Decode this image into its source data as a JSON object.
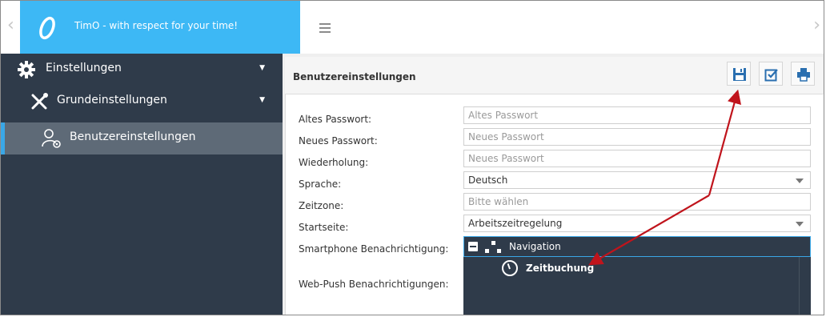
{
  "header": {
    "app_title": "TimO - with respect for your time!",
    "nav_prev": "‹",
    "nav_next": "›"
  },
  "sidebar": {
    "items": [
      {
        "label": "Einstellungen",
        "icon": "gear-icon",
        "caret": "▼"
      },
      {
        "label": "Grundeinstellungen",
        "icon": "tools-icon",
        "caret": "▼"
      },
      {
        "label": "Benutzereinstellungen",
        "icon": "user-settings-icon",
        "active": true
      }
    ]
  },
  "panel": {
    "title": "Benutzereinstellungen",
    "toolbar": {
      "save_icon": "save-icon",
      "check_icon": "checkbox-icon",
      "print_icon": "print-icon"
    }
  },
  "form": {
    "old_password": {
      "label": "Altes Passwort:",
      "placeholder": "Altes Passwort"
    },
    "new_password": {
      "label": "Neues Passwort:",
      "placeholder": "Neues Passwort"
    },
    "repeat_password": {
      "label": "Wiederholung:",
      "placeholder": "Neues Passwort"
    },
    "language": {
      "label": "Sprache:",
      "value": "Deutsch"
    },
    "timezone": {
      "label": "Zeitzone:",
      "placeholder": "Bitte wählen"
    },
    "start_page": {
      "label": "Startseite:",
      "value": "Arbeitszeitregelung"
    },
    "smartphone": {
      "label": "Smartphone Benachrichtigung:"
    },
    "webpush": {
      "label": "Web-Push Benachrichtigungen:"
    }
  },
  "tree": {
    "root": "Navigation",
    "child": "Zeitbuchung"
  },
  "colors": {
    "brand": "#3db8f5",
    "sidebar": "#2f3b4a",
    "sidebar_active": "#5e6a77",
    "accent": "#3aa7e6",
    "annotation_arrow": "#c0141c",
    "toolbar_icon": "#2a6fb0"
  }
}
